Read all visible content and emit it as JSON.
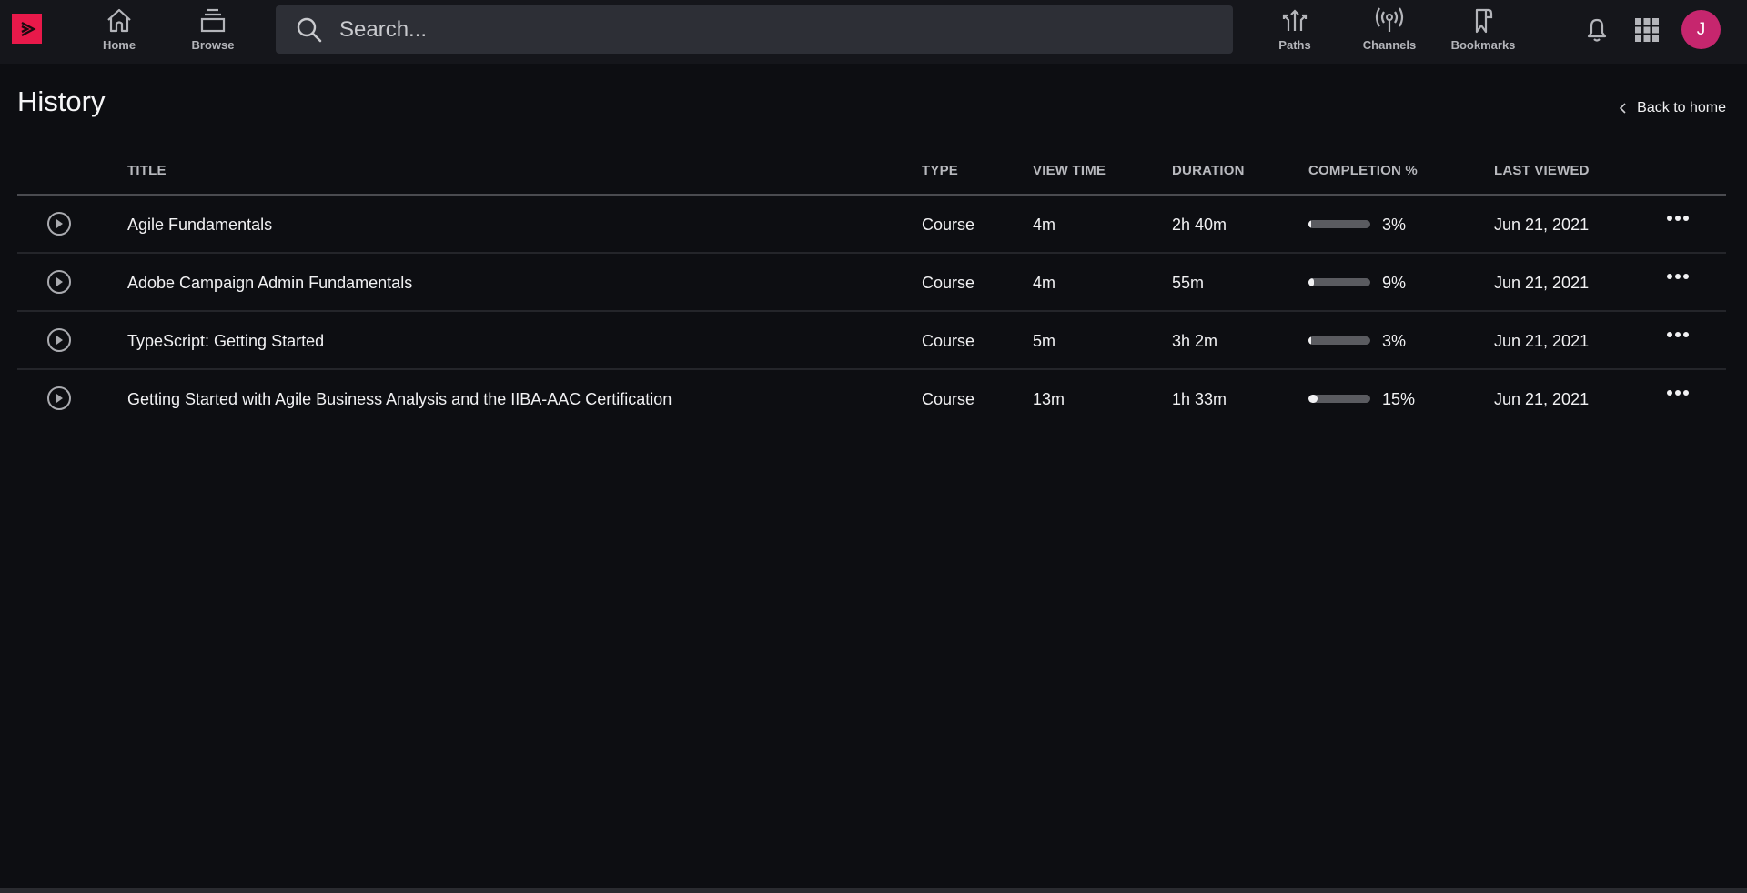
{
  "nav": {
    "home_label": "Home",
    "browse_label": "Browse",
    "search_placeholder": "Search...",
    "paths_label": "Paths",
    "channels_label": "Channels",
    "bookmarks_label": "Bookmarks",
    "avatar_initial": "J"
  },
  "colors": {
    "brand": "#e8194a",
    "avatar": "#c6266e",
    "background": "#0d0e12",
    "topbar": "#15161b"
  },
  "page": {
    "title": "History",
    "back_label": "Back to home"
  },
  "table": {
    "headers": {
      "title": "TITLE",
      "type": "TYPE",
      "view_time": "VIEW TIME",
      "duration": "DURATION",
      "completion": "COMPLETION %",
      "last_viewed": "LAST VIEWED"
    },
    "rows": [
      {
        "title": "Agile Fundamentals",
        "type": "Course",
        "view_time": "4m",
        "duration": "2h 40m",
        "completion": 3,
        "completion_label": "3%",
        "last_viewed": "Jun 21, 2021"
      },
      {
        "title": "Adobe Campaign Admin Fundamentals",
        "type": "Course",
        "view_time": "4m",
        "duration": "55m",
        "completion": 9,
        "completion_label": "9%",
        "last_viewed": "Jun 21, 2021"
      },
      {
        "title": "TypeScript: Getting Started",
        "type": "Course",
        "view_time": "5m",
        "duration": "3h 2m",
        "completion": 3,
        "completion_label": "3%",
        "last_viewed": "Jun 21, 2021"
      },
      {
        "title": "Getting Started with Agile Business Analysis and the IIBA-AAC Certification",
        "type": "Course",
        "view_time": "13m",
        "duration": "1h 33m",
        "completion": 15,
        "completion_label": "15%",
        "last_viewed": "Jun 21, 2021"
      }
    ]
  }
}
